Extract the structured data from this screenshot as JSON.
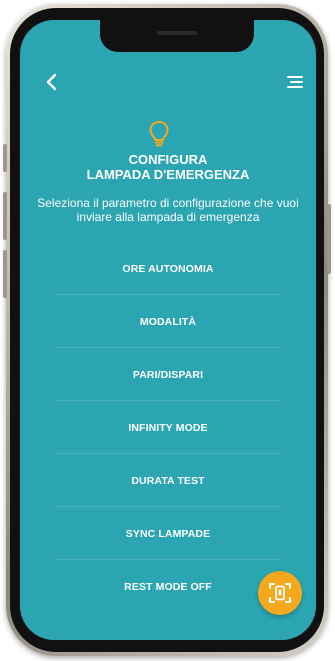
{
  "app": {
    "title_line1": "CONFIGURA",
    "title_line2": "LAMPADA D'EMERGENZA",
    "subtitle": "Seleziona il parametro di configurazione che vuoi inviare alla lampada di emergenza"
  },
  "options": [
    {
      "label": "ORE AUTONOMIA"
    },
    {
      "label": "MODALITÀ"
    },
    {
      "label": "PARI/DISPARI"
    },
    {
      "label": "INFINITY MODE"
    },
    {
      "label": "DURATA TEST"
    },
    {
      "label": "SYNC LAMPADE"
    },
    {
      "label": "REST MODE OFF"
    }
  ],
  "icons": {
    "back": "chevron-left-icon",
    "menu": "menu-icon",
    "header": "lightbulb-icon",
    "fab": "device-scan-icon"
  },
  "colors": {
    "background": "#2aa5b1",
    "accent": "#f4a81e",
    "text": "#ffffff"
  }
}
